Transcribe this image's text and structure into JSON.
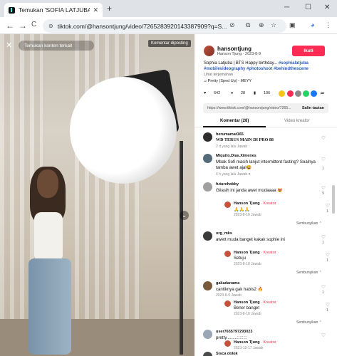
{
  "browser": {
    "tab_title": "Temukan 'SOFIA LATJUBA' di",
    "tab_close": "✕",
    "new_tab": "+",
    "minimize": "─",
    "maximize": "☐",
    "close": "✕",
    "url": "tiktok.com/@hansontjung/video/7265283920143387909?q=S...",
    "back": "←",
    "forward": "→",
    "reload": "C"
  },
  "video": {
    "search_pill": "Temukan konten terkait",
    "badge": "Komentar diposting",
    "close": "✕",
    "next": "⌄"
  },
  "author": {
    "username": "hansontjung",
    "display": "Hanson Tjung · 2023-8-9",
    "follow_label": "Ikuti",
    "caption_text": "Sophia Latjuba | BTS Happy birthday... ",
    "caption_tags": "#sophialatjuba #mobilevideography #photoshoot #behindthescene",
    "translate": "Lihat terjemahan",
    "music": "♫ Pretty (Sped Up) - MEYY"
  },
  "stats": {
    "likes": "642",
    "comments": "28",
    "saves": "106"
  },
  "link": {
    "url": "https://www.tiktok.com/@hansontjung/video/7265...",
    "copy_label": "Salin tautan"
  },
  "tabs": {
    "comments": "Komentar (28)",
    "creator": "Video kreator"
  },
  "comments": [
    {
      "name": "herumamat165",
      "text": "WD TERUS MAIN DI PRO 88",
      "meta": "2 d yang lalu    Jawab",
      "likes": "",
      "avatar_color": "#2d2d2d"
    },
    {
      "name": "Miquito.Dias.Ximenes",
      "text": "Mbak Sofi masih lanjut intermittent fasting? Soalnya tamba awet ajal😆",
      "meta": "4 h yang lalu    Jawab  ♥",
      "likes": "1",
      "avatar_color": "#556b7a"
    },
    {
      "name": "futurehobby",
      "text": "Gilasih ini janda awet mudaaaa 😻",
      "meta": "2023-8-9    Jawab",
      "likes": "9",
      "avatar_color": "#a0a0a0"
    },
    {
      "name": "org_mks",
      "text": "awett muda banget kakak sophie ini",
      "meta": "2023-8-9    Jawab",
      "likes": "1",
      "avatar_color": "#3a3a3a"
    },
    {
      "name": "gakadanama",
      "text": "cantiknya gak habis2 🔥",
      "meta": "2023-8-9    Jawab",
      "likes": "1",
      "avatar_color": "#7a5a3a"
    },
    {
      "name": "user7655797293023",
      "text": "pretty.........::::::::",
      "meta": "",
      "likes": "",
      "avatar_color": "#9aa5b5"
    },
    {
      "name": "Sisca dolok",
      "text": "",
      "meta": "",
      "likes": "",
      "avatar_color": "#4a4a4a"
    }
  ],
  "replies": [
    {
      "name": "Hanson Tjung",
      "tag": " · Kreator",
      "text": "🙏🙏🙏",
      "meta": "2023-8-10    Jawab",
      "likes": "1"
    },
    {
      "name": "Hanson Tjung",
      "tag": " · Kreator",
      "text": "Setuju",
      "meta": "2023-8-10    Jawab",
      "likes": "1"
    },
    {
      "name": "Hanson Tjung",
      "tag": " · Kreator",
      "text": "Bener banget",
      "meta": "2023-8-10    Jawab",
      "likes": "1"
    },
    {
      "name": "Hanson Tjung",
      "tag": " · Kreator",
      "text": "",
      "meta": "2023-10-17    Jawab",
      "likes": ""
    }
  ],
  "more_label": "Sembunyikan ⌃",
  "colors": {
    "accent": "#fe2c55",
    "tag": "#2b5db9"
  }
}
